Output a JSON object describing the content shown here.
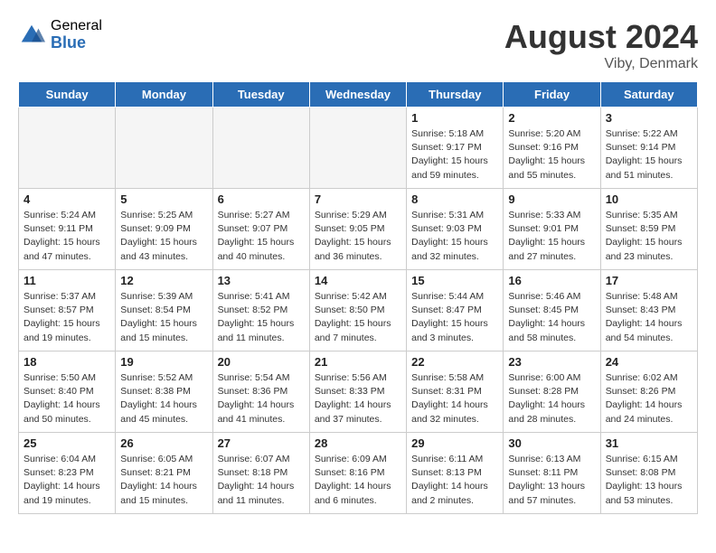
{
  "header": {
    "logo_general": "General",
    "logo_blue": "Blue",
    "month_title": "August 2024",
    "location": "Viby, Denmark"
  },
  "weekdays": [
    "Sunday",
    "Monday",
    "Tuesday",
    "Wednesday",
    "Thursday",
    "Friday",
    "Saturday"
  ],
  "weeks": [
    [
      {
        "day": "",
        "info": ""
      },
      {
        "day": "",
        "info": ""
      },
      {
        "day": "",
        "info": ""
      },
      {
        "day": "",
        "info": ""
      },
      {
        "day": "1",
        "info": "Sunrise: 5:18 AM\nSunset: 9:17 PM\nDaylight: 15 hours\nand 59 minutes."
      },
      {
        "day": "2",
        "info": "Sunrise: 5:20 AM\nSunset: 9:16 PM\nDaylight: 15 hours\nand 55 minutes."
      },
      {
        "day": "3",
        "info": "Sunrise: 5:22 AM\nSunset: 9:14 PM\nDaylight: 15 hours\nand 51 minutes."
      }
    ],
    [
      {
        "day": "4",
        "info": "Sunrise: 5:24 AM\nSunset: 9:11 PM\nDaylight: 15 hours\nand 47 minutes."
      },
      {
        "day": "5",
        "info": "Sunrise: 5:25 AM\nSunset: 9:09 PM\nDaylight: 15 hours\nand 43 minutes."
      },
      {
        "day": "6",
        "info": "Sunrise: 5:27 AM\nSunset: 9:07 PM\nDaylight: 15 hours\nand 40 minutes."
      },
      {
        "day": "7",
        "info": "Sunrise: 5:29 AM\nSunset: 9:05 PM\nDaylight: 15 hours\nand 36 minutes."
      },
      {
        "day": "8",
        "info": "Sunrise: 5:31 AM\nSunset: 9:03 PM\nDaylight: 15 hours\nand 32 minutes."
      },
      {
        "day": "9",
        "info": "Sunrise: 5:33 AM\nSunset: 9:01 PM\nDaylight: 15 hours\nand 27 minutes."
      },
      {
        "day": "10",
        "info": "Sunrise: 5:35 AM\nSunset: 8:59 PM\nDaylight: 15 hours\nand 23 minutes."
      }
    ],
    [
      {
        "day": "11",
        "info": "Sunrise: 5:37 AM\nSunset: 8:57 PM\nDaylight: 15 hours\nand 19 minutes."
      },
      {
        "day": "12",
        "info": "Sunrise: 5:39 AM\nSunset: 8:54 PM\nDaylight: 15 hours\nand 15 minutes."
      },
      {
        "day": "13",
        "info": "Sunrise: 5:41 AM\nSunset: 8:52 PM\nDaylight: 15 hours\nand 11 minutes."
      },
      {
        "day": "14",
        "info": "Sunrise: 5:42 AM\nSunset: 8:50 PM\nDaylight: 15 hours\nand 7 minutes."
      },
      {
        "day": "15",
        "info": "Sunrise: 5:44 AM\nSunset: 8:47 PM\nDaylight: 15 hours\nand 3 minutes."
      },
      {
        "day": "16",
        "info": "Sunrise: 5:46 AM\nSunset: 8:45 PM\nDaylight: 14 hours\nand 58 minutes."
      },
      {
        "day": "17",
        "info": "Sunrise: 5:48 AM\nSunset: 8:43 PM\nDaylight: 14 hours\nand 54 minutes."
      }
    ],
    [
      {
        "day": "18",
        "info": "Sunrise: 5:50 AM\nSunset: 8:40 PM\nDaylight: 14 hours\nand 50 minutes."
      },
      {
        "day": "19",
        "info": "Sunrise: 5:52 AM\nSunset: 8:38 PM\nDaylight: 14 hours\nand 45 minutes."
      },
      {
        "day": "20",
        "info": "Sunrise: 5:54 AM\nSunset: 8:36 PM\nDaylight: 14 hours\nand 41 minutes."
      },
      {
        "day": "21",
        "info": "Sunrise: 5:56 AM\nSunset: 8:33 PM\nDaylight: 14 hours\nand 37 minutes."
      },
      {
        "day": "22",
        "info": "Sunrise: 5:58 AM\nSunset: 8:31 PM\nDaylight: 14 hours\nand 32 minutes."
      },
      {
        "day": "23",
        "info": "Sunrise: 6:00 AM\nSunset: 8:28 PM\nDaylight: 14 hours\nand 28 minutes."
      },
      {
        "day": "24",
        "info": "Sunrise: 6:02 AM\nSunset: 8:26 PM\nDaylight: 14 hours\nand 24 minutes."
      }
    ],
    [
      {
        "day": "25",
        "info": "Sunrise: 6:04 AM\nSunset: 8:23 PM\nDaylight: 14 hours\nand 19 minutes."
      },
      {
        "day": "26",
        "info": "Sunrise: 6:05 AM\nSunset: 8:21 PM\nDaylight: 14 hours\nand 15 minutes."
      },
      {
        "day": "27",
        "info": "Sunrise: 6:07 AM\nSunset: 8:18 PM\nDaylight: 14 hours\nand 11 minutes."
      },
      {
        "day": "28",
        "info": "Sunrise: 6:09 AM\nSunset: 8:16 PM\nDaylight: 14 hours\nand 6 minutes."
      },
      {
        "day": "29",
        "info": "Sunrise: 6:11 AM\nSunset: 8:13 PM\nDaylight: 14 hours\nand 2 minutes."
      },
      {
        "day": "30",
        "info": "Sunrise: 6:13 AM\nSunset: 8:11 PM\nDaylight: 13 hours\nand 57 minutes."
      },
      {
        "day": "31",
        "info": "Sunrise: 6:15 AM\nSunset: 8:08 PM\nDaylight: 13 hours\nand 53 minutes."
      }
    ]
  ]
}
